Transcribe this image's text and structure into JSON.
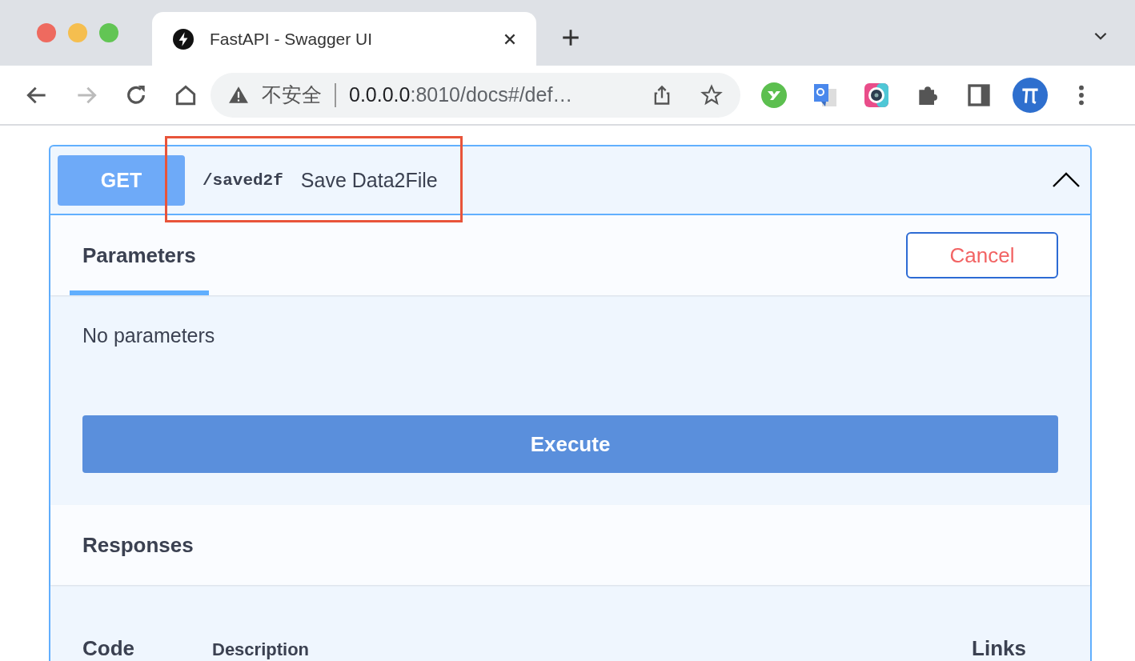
{
  "browser": {
    "tab": {
      "title": "FastAPI - Swagger UI",
      "selected": true
    },
    "security_label": "不安全",
    "url": {
      "host": "0.0.0.0",
      "path": ":8010/docs#/def…"
    }
  },
  "operation": {
    "method": "GET",
    "path": "/saved2f",
    "summary": "Save Data2File",
    "expanded": true,
    "tabs": [
      {
        "label": "Parameters",
        "selected": true
      }
    ],
    "cancel_label": "Cancel",
    "empty_parameters": "No parameters",
    "execute_label": "Execute",
    "responses_title": "Responses",
    "columns": [
      "Code",
      "Description",
      "Links"
    ]
  }
}
